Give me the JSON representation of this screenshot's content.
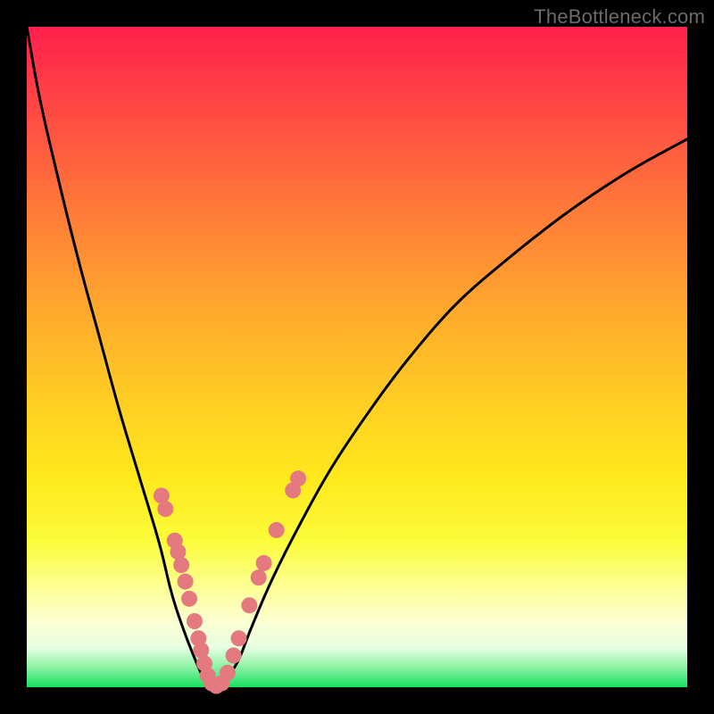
{
  "watermark": "TheBottleneck.com",
  "colors": {
    "frame": "#000000",
    "curve": "#000000",
    "marker_fill": "#e47a7f",
    "marker_stroke": "#c95f63"
  },
  "chart_data": {
    "type": "line",
    "title": "",
    "xlabel": "",
    "ylabel": "",
    "xlim": [
      0,
      100
    ],
    "ylim": [
      0,
      100
    ],
    "grid": false,
    "legend": false,
    "series": [
      {
        "name": "bottleneck-curve",
        "x": [
          0,
          2,
          5,
          8,
          11,
          14,
          17,
          20,
          22,
          24,
          26,
          27,
          28,
          29,
          30,
          32,
          34,
          37,
          41,
          46,
          52,
          58,
          65,
          73,
          82,
          91,
          100
        ],
        "y": [
          100,
          89,
          76,
          64,
          53,
          42,
          32,
          22,
          14,
          8,
          3,
          1,
          0,
          0,
          1,
          4,
          9,
          16,
          24,
          33,
          42,
          50,
          58,
          65,
          72,
          78,
          83
        ]
      }
    ],
    "markers": [
      {
        "x": 20.4,
        "y": 29.0
      },
      {
        "x": 21.0,
        "y": 27.0
      },
      {
        "x": 22.4,
        "y": 22.2
      },
      {
        "x": 22.9,
        "y": 20.5
      },
      {
        "x": 23.4,
        "y": 18.5
      },
      {
        "x": 24.0,
        "y": 16.0
      },
      {
        "x": 24.6,
        "y": 13.4
      },
      {
        "x": 25.4,
        "y": 10.0
      },
      {
        "x": 26.0,
        "y": 7.4
      },
      {
        "x": 26.4,
        "y": 5.6
      },
      {
        "x": 26.9,
        "y": 3.6
      },
      {
        "x": 27.4,
        "y": 1.8
      },
      {
        "x": 28.0,
        "y": 0.6
      },
      {
        "x": 28.7,
        "y": 0.2
      },
      {
        "x": 29.5,
        "y": 0.6
      },
      {
        "x": 30.4,
        "y": 2.2
      },
      {
        "x": 31.3,
        "y": 4.8
      },
      {
        "x": 32.1,
        "y": 7.4
      },
      {
        "x": 33.7,
        "y": 12.4
      },
      {
        "x": 35.1,
        "y": 16.6
      },
      {
        "x": 35.9,
        "y": 18.8
      },
      {
        "x": 37.8,
        "y": 23.8
      },
      {
        "x": 40.3,
        "y": 29.8
      },
      {
        "x": 41.1,
        "y": 31.6
      }
    ]
  }
}
